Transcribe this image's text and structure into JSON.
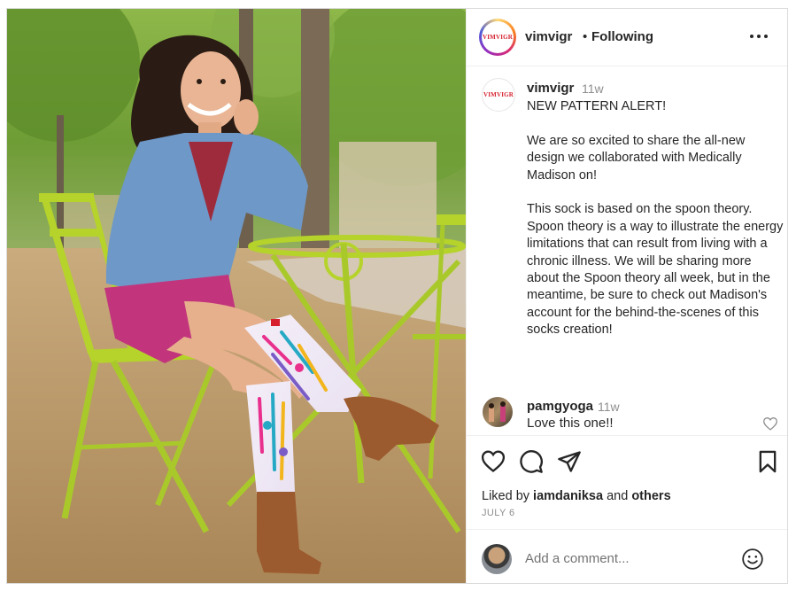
{
  "post": {
    "author": "vimvigr",
    "follow_status": "Following",
    "brand_logo_text": "VIMVIGR",
    "brand_color": "#d6202e"
  },
  "caption": {
    "username": "vimvigr",
    "time": "11w",
    "paragraphs": [
      "NEW PATTERN ALERT!",
      "We are so excited to share the all-new design we collaborated with Medically Madison on!",
      "This sock is based on the spoon theory. Spoon theory is a way to illustrate the energy limitations that can result from living with a chronic illness. We will be sharing more about the Spoon theory all week, but in the meantime, be sure to check out Madison's account for the behind-the-scenes of this socks creation!"
    ]
  },
  "comment": {
    "username": "pamgyoga",
    "time": "11w",
    "text": "Love this one!!"
  },
  "likes": {
    "prefix": "Liked by",
    "user": "iamdaniksa",
    "joiner": "and",
    "others": "others"
  },
  "date": "JULY 6",
  "add_comment": {
    "placeholder": "Add a comment..."
  },
  "icons": {
    "more": "more-options-icon",
    "like": "heart-icon",
    "comment": "comment-icon",
    "share": "paper-plane-icon",
    "save": "bookmark-icon",
    "emoji": "smiley-icon"
  },
  "colors": {
    "text": "#262626",
    "muted": "#8e8e8e",
    "divider": "#efefef",
    "sock_accent": "#e8308c"
  }
}
